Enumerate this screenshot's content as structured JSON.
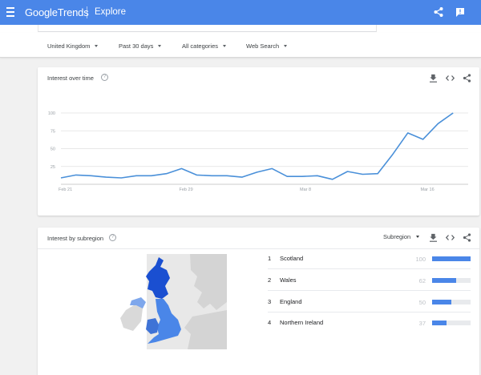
{
  "appbar": {
    "logo_google": "Google",
    "logo_trends": "Trends",
    "section": "Explore"
  },
  "filters": [
    {
      "label": "United Kingdom"
    },
    {
      "label": "Past 30 days"
    },
    {
      "label": "All categories"
    },
    {
      "label": "Web Search"
    }
  ],
  "interest_over_time": {
    "title": "Interest over time",
    "help": "?"
  },
  "subregion": {
    "title": "Interest by subregion",
    "help": "?",
    "select_label": "Subregion",
    "rows": [
      {
        "rank": "1",
        "name": "Scotland",
        "value": "100",
        "pct": 100
      },
      {
        "rank": "2",
        "name": "Wales",
        "value": "62",
        "pct": 62
      },
      {
        "rank": "3",
        "name": "England",
        "value": "50",
        "pct": 50
      },
      {
        "rank": "4",
        "name": "Northern Ireland",
        "value": "37",
        "pct": 37
      }
    ]
  },
  "colors": {
    "brand": "#4a86e8",
    "line": "#4a90d9",
    "grid": "#e0e0e0"
  },
  "chart_data": {
    "type": "line",
    "x": [
      "Feb 21",
      "Feb 22",
      "Feb 23",
      "Feb 24",
      "Feb 25",
      "Feb 26",
      "Feb 27",
      "Feb 28",
      "Feb 29",
      "Mar 1",
      "Mar 2",
      "Mar 3",
      "Mar 4",
      "Mar 5",
      "Mar 6",
      "Mar 7",
      "Mar 8",
      "Mar 9",
      "Mar 10",
      "Mar 11",
      "Mar 12",
      "Mar 13",
      "Mar 14",
      "Mar 15",
      "Mar 16",
      "Mar 17",
      "Mar 18",
      "Mar 19"
    ],
    "values": [
      9,
      13,
      12,
      10,
      9,
      12,
      12,
      15,
      22,
      13,
      12,
      12,
      10,
      17,
      22,
      11,
      11,
      12,
      7,
      18,
      14,
      15,
      42,
      72,
      63,
      85,
      100,
      null
    ],
    "x_tick_labels": [
      "Feb 21",
      "Feb 29",
      "Mar 8",
      "Mar 16"
    ],
    "x_tick_indices": [
      0,
      8,
      16,
      24
    ],
    "y_ticks": [
      25,
      50,
      75,
      100
    ],
    "ylim": [
      0,
      100
    ],
    "grid": true,
    "series": [
      {
        "values_ref": "values"
      }
    ]
  }
}
